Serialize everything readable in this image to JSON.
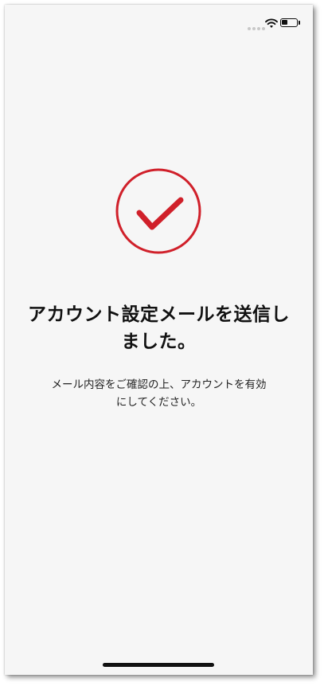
{
  "status_bar": {
    "wifi_icon": "wifi-icon",
    "battery_icon": "battery-icon",
    "battery_level": 0.4
  },
  "main": {
    "success_icon": "checkmark-circle-icon",
    "title": "アカウント設定メールを送信しました。",
    "message": "メール内容をご確認の上、アカウントを有効にしてください。"
  },
  "colors": {
    "accent": "#d0202a",
    "background": "#f6f6f6",
    "text": "#111111"
  }
}
